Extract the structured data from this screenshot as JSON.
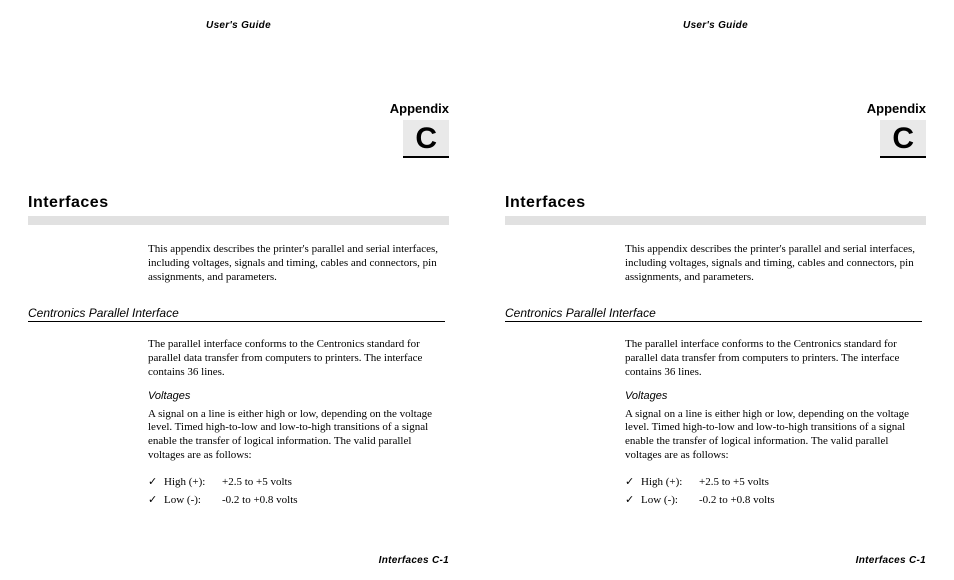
{
  "header": "User's Guide",
  "appendix": {
    "label": "Appendix",
    "letter": "C"
  },
  "section_title": "Interfaces",
  "intro": "This appendix describes the printer's parallel and serial interfaces, including voltages, signals and timing, cables and connectors, pin assignments, and parameters.",
  "sub_heading": "Centronics Parallel Interface",
  "parallel_intro": "The parallel interface conforms to the Centronics standard for parallel data transfer from computers to printers.  The interface contains 36 lines.",
  "voltages_heading": "Voltages",
  "voltages_text": "A signal on a line is either high or low, depending on the voltage level. Timed high-to-low and low-to-high transitions of a signal enable the transfer of logical information.  The valid parallel voltages are as follows:",
  "rows": [
    {
      "label": "High (+):",
      "value": "+2.5 to +5 volts"
    },
    {
      "label": "Low (-):",
      "value": "-0.2 to +0.8 volts"
    }
  ],
  "footer": "Interfaces C-1",
  "checkmark": "✓"
}
